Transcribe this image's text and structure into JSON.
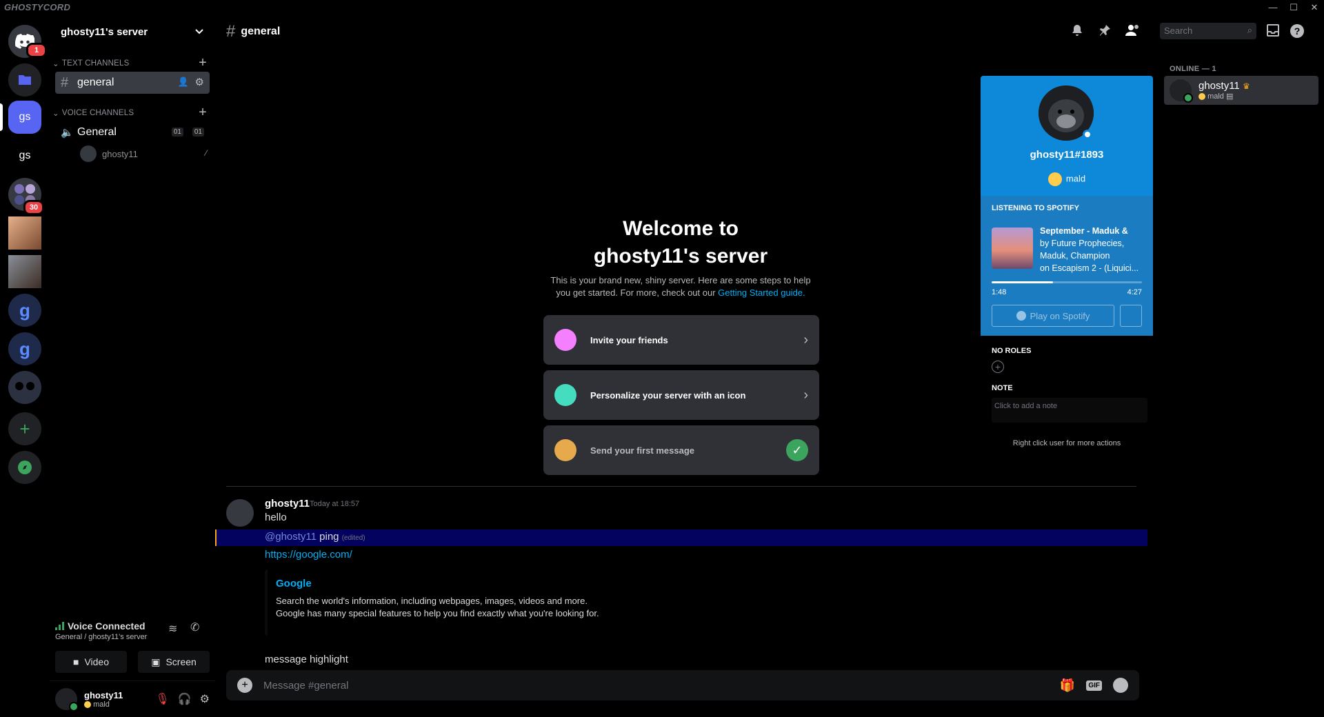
{
  "app": {
    "brand": "GHOSTYCORD"
  },
  "rail": {
    "home_badge": "1",
    "server_badge": "30",
    "active_server": "gs",
    "server_label": "gs"
  },
  "server": {
    "name": "ghosty11's server",
    "text_category": "TEXT CHANNELS",
    "voice_category": "VOICE CHANNELS",
    "text_channel": "general",
    "voice_channel": "General",
    "voice_count_a": "01",
    "voice_count_b": "01",
    "voice_user": "ghosty11"
  },
  "voice": {
    "status": "Voice Connected",
    "location": "General / ghosty11's server",
    "video_label": "Video",
    "screen_label": "Screen"
  },
  "user": {
    "name": "ghosty11",
    "status": "mald"
  },
  "header": {
    "channel": "general",
    "search_placeholder": "Search"
  },
  "welcome": {
    "title_line1": "Welcome to",
    "title_line2": "ghosty11's server",
    "desc": "This is your brand new, shiny server. Here are some steps to help you get started. For more, check out our ",
    "link": "Getting Started guide.",
    "cards": [
      "Invite your friends",
      "Personalize your server with an icon",
      "Send your first message"
    ]
  },
  "messages": {
    "author": "ghosty11",
    "time": "Today at 18:57",
    "line1": "hello",
    "mention": "@ghosty11",
    "mention_text": " ping ",
    "edited": "(edited)",
    "url": "https://google.com/",
    "embed_title": "Google",
    "embed_desc": "Search the world's information, including webpages, images, videos and more. Google has many special features to help you find exactly what you're looking for.",
    "line_last": "message highlight"
  },
  "composer": {
    "placeholder": "Message #general"
  },
  "profile": {
    "tag": "ghosty11#1893",
    "status": "mald",
    "spotify_label": "LISTENING TO SPOTIFY",
    "track_title": "September - Maduk &",
    "track_artists": "by Future Prophecies, Maduk, Champion",
    "track_album": "on Escapism 2 - (Liquici...",
    "elapsed": "1:48",
    "duration": "4:27",
    "progress_fraction": 0.41,
    "play_label": "Play on Spotify",
    "roles_label": "NO ROLES",
    "note_label": "NOTE",
    "note_placeholder": "Click to add a note",
    "hint": "Right click user for more actions"
  },
  "members": {
    "heading": "ONLINE — 1",
    "list": [
      {
        "name": "ghosty11",
        "status": "mald"
      }
    ]
  },
  "colors": {
    "accent": "#5865f2",
    "popout_banner": "#0e88d8",
    "mention_bg": "#03035f",
    "online": "#3ba55d"
  }
}
